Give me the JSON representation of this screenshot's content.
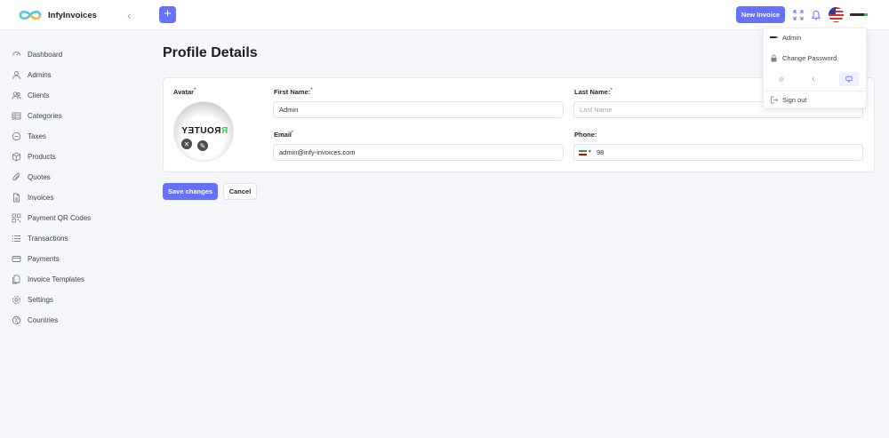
{
  "app": {
    "name": "InfyInvoices"
  },
  "header": {
    "new_invoice_label": "New Invoice",
    "icons": [
      "expand-icon",
      "bell-icon",
      "us-flag-icon",
      "user-avatar"
    ],
    "accent": "#6571ff"
  },
  "sidebar": {
    "items": [
      {
        "label": "Dashboard",
        "icon": "dashboard-icon"
      },
      {
        "label": "Admins",
        "icon": "user-icon"
      },
      {
        "label": "Clients",
        "icon": "users-icon"
      },
      {
        "label": "Categories",
        "icon": "list-icon"
      },
      {
        "label": "Taxes",
        "icon": "tax-icon"
      },
      {
        "label": "Products",
        "icon": "box-icon"
      },
      {
        "label": "Quotes",
        "icon": "paperclip-icon"
      },
      {
        "label": "Invoices",
        "icon": "file-icon"
      },
      {
        "label": "Payment QR Codes",
        "icon": "qr-icon"
      },
      {
        "label": "Transactions",
        "icon": "transactions-icon"
      },
      {
        "label": "Payments",
        "icon": "card-icon"
      },
      {
        "label": "Invoice Templates",
        "icon": "templates-icon"
      },
      {
        "label": "Settings",
        "icon": "gear-icon"
      },
      {
        "label": "Countries",
        "icon": "globe-icon"
      }
    ]
  },
  "main": {
    "title": "Profile Details",
    "avatar_label": "Avatar",
    "avatar_text": "ROUTEY",
    "form": {
      "first_name_label": "First Name:",
      "first_name_value": "Admin",
      "last_name_label": "Last Name:",
      "last_name_placeholder": "Last Name",
      "email_label": "Email",
      "email_value": "admin@infy-invoices.com",
      "phone_label": "Phone:",
      "phone_value": "98",
      "required_mark": "*"
    },
    "save_label": "Save changes",
    "cancel_label": "Cancel"
  },
  "dropdown": {
    "user_name": "Admin",
    "change_password": "Change Password",
    "theme_options": [
      "light-theme-icon",
      "dark-theme-icon",
      "system-theme-icon"
    ],
    "selected_theme": "system",
    "sign_out": "Sign out"
  }
}
